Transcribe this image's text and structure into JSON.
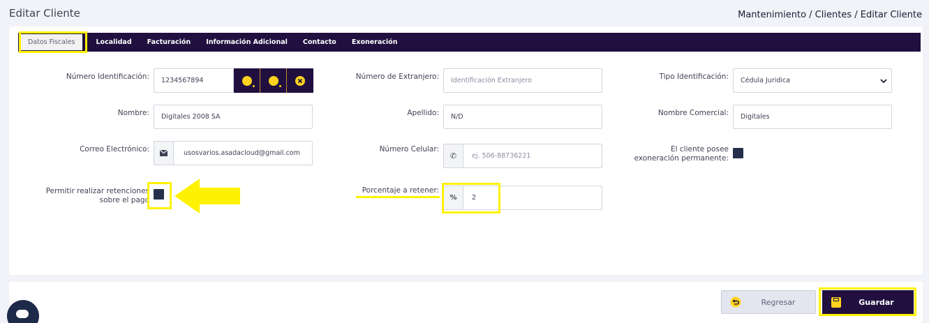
{
  "page": {
    "title": "Editar Cliente",
    "breadcrumb": "Mantenimiento / Clientes / Editar Cliente"
  },
  "tabs": [
    "Datos Fiscales",
    "Localidad",
    "Facturación",
    "Información Adicional",
    "Contacto",
    "Exoneración"
  ],
  "form": {
    "numero_identificacion": {
      "label": "Número Identificación:",
      "value": "1234567894"
    },
    "numero_extranjero": {
      "label": "Número de Extranjero:",
      "placeholder": "Identificación Extranjero"
    },
    "tipo_identificacion": {
      "label": "Tipo Identificación:",
      "value": "Cédula Juridica"
    },
    "nombre": {
      "label": "Nombre:",
      "value": "Digitales 2008 SA"
    },
    "apellido": {
      "label": "Apellido:",
      "value": "N/D"
    },
    "nombre_comercial": {
      "label": "Nombre Comercial:",
      "value": "Digitales"
    },
    "correo": {
      "label": "Correo Electrónico:",
      "value": "usosvarios.asadacloud@gmail.com"
    },
    "celular": {
      "label": "Número Celular:",
      "placeholder": "ej. 506-88736221"
    },
    "exoneracion_permanente": {
      "label_line1": "El cliente posee",
      "label_line2": "exoneración permanente:"
    },
    "retenciones": {
      "label_line1": "Permitir realizar retenciones",
      "label_line2": "sobre el pago"
    },
    "porcentaje": {
      "label": "Porcentaje a retener:",
      "addon": "%",
      "value": "2"
    }
  },
  "buttons": {
    "back": "Regresar",
    "save": "Guardar"
  },
  "colors": {
    "primary": "#200f3f",
    "accent": "#ffd21f",
    "highlight": "#fff200"
  }
}
